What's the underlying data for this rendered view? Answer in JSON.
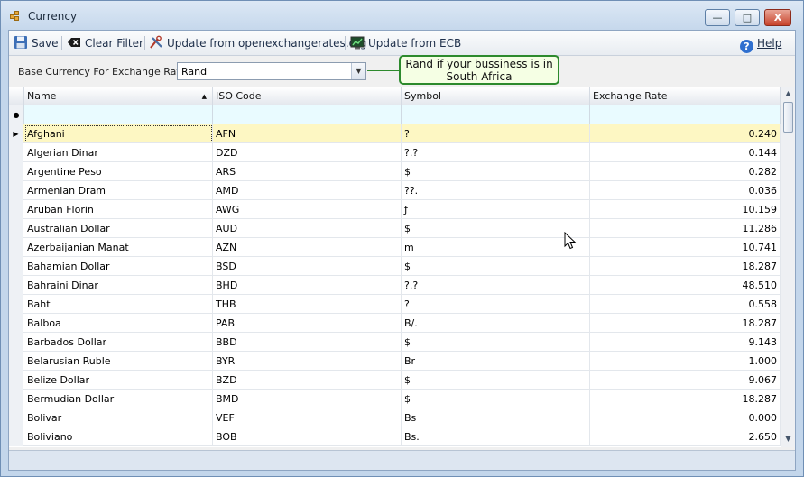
{
  "window": {
    "title": "Currency",
    "minimize_glyph": "—",
    "maximize_glyph": "□",
    "close_glyph": "X"
  },
  "toolbar": {
    "save_label": "Save",
    "clear_filter_label": "Clear Filter",
    "update_oer_label": "Update from openexchangerates.org",
    "update_ecb_label": "Update from ECB",
    "help_label": "Help",
    "help_icon_glyph": "?"
  },
  "base_currency": {
    "label": "Base Currency For Exchange Rates",
    "value": "Rand"
  },
  "callout": {
    "text": "Rand if your bussiness is in South Africa"
  },
  "grid": {
    "columns": [
      "Name",
      "ISO Code",
      "Symbol",
      "Exchange Rate"
    ],
    "sort_indicator": "▲",
    "row_indicator": "▶",
    "filter_row_icon": "●",
    "rows": [
      {
        "name": "Afghani",
        "iso": "AFN",
        "symbol": "?",
        "rate": "0.240"
      },
      {
        "name": "Algerian Dinar",
        "iso": "DZD",
        "symbol": "?.?",
        "rate": "0.144"
      },
      {
        "name": "Argentine Peso",
        "iso": "ARS",
        "symbol": "$",
        "rate": "0.282"
      },
      {
        "name": "Armenian Dram",
        "iso": "AMD",
        "symbol": "??.",
        "rate": "0.036"
      },
      {
        "name": "Aruban Florin",
        "iso": "AWG",
        "symbol": "ƒ",
        "rate": "10.159"
      },
      {
        "name": "Australian Dollar",
        "iso": "AUD",
        "symbol": "$",
        "rate": "11.286"
      },
      {
        "name": "Azerbaijanian Manat",
        "iso": "AZN",
        "symbol": "m",
        "rate": "10.741"
      },
      {
        "name": "Bahamian Dollar",
        "iso": "BSD",
        "symbol": "$",
        "rate": "18.287"
      },
      {
        "name": "Bahraini Dinar",
        "iso": "BHD",
        "symbol": "?.?",
        "rate": "48.510"
      },
      {
        "name": "Baht",
        "iso": "THB",
        "symbol": "?",
        "rate": "0.558"
      },
      {
        "name": "Balboa",
        "iso": "PAB",
        "symbol": "B/.",
        "rate": "18.287"
      },
      {
        "name": "Barbados Dollar",
        "iso": "BBD",
        "symbol": "$",
        "rate": "9.143"
      },
      {
        "name": "Belarusian Ruble",
        "iso": "BYR",
        "symbol": "Br",
        "rate": "1.000"
      },
      {
        "name": "Belize Dollar",
        "iso": "BZD",
        "symbol": "$",
        "rate": "9.067"
      },
      {
        "name": "Bermudian Dollar",
        "iso": "BMD",
        "symbol": "$",
        "rate": "18.287"
      },
      {
        "name": "Bolivar",
        "iso": "VEF",
        "symbol": "Bs",
        "rate": "0.000"
      },
      {
        "name": "Boliviano",
        "iso": "BOB",
        "symbol": "Bs.",
        "rate": "2.650"
      }
    ]
  },
  "scrollbar": {
    "up_arrow": "▲",
    "down_arrow": "▼"
  },
  "colors": {
    "active_row": "#fdf7c3",
    "filter_row": "#e9fbff",
    "callout_border": "#2d8a2d"
  }
}
